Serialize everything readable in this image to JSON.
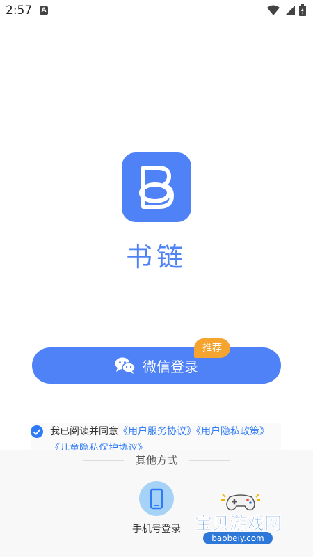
{
  "status_bar": {
    "time": "2:57",
    "indicator": "A"
  },
  "app": {
    "name": "书链",
    "logo_letter": "B"
  },
  "colors": {
    "primary": "#4f82f7",
    "badge": "#f5a430",
    "link": "#2f7bf6"
  },
  "login": {
    "wechat_label": "微信登录",
    "recommend_badge": "推荐"
  },
  "agreement": {
    "prefix": "我已阅读并同意",
    "links": [
      "《用户服务协议》",
      "《用户隐私政策》",
      "《儿童隐私保护协议》"
    ],
    "checked": true
  },
  "other": {
    "title": "其他方式",
    "phone_label": "手机号登录"
  },
  "watermark": {
    "title": "宝贝游戏网",
    "url": "baobeiy.com"
  }
}
